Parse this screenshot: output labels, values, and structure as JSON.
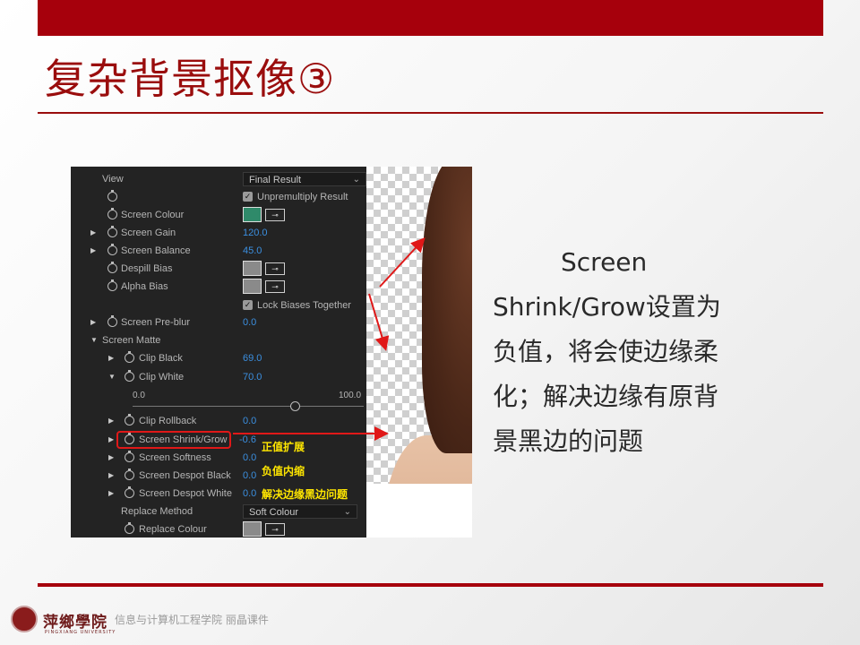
{
  "slide": {
    "title": "复杂背景抠像③",
    "footer": "信息与计算机工程学院  丽晶课件",
    "logo_text": "萍鄉學院",
    "logo_sub": "PINGXIANG UNIVERSITY"
  },
  "description": {
    "lines": [
      "Screen",
      "Shrink/Grow设置为",
      "负值，将会使边缘柔",
      "化；解决边缘有原背",
      "景黑边的问题"
    ]
  },
  "panel": {
    "view_label": "View",
    "view_value": "Final Result",
    "unpremultiply_label": "Unpremultiply Result",
    "screen_colour": {
      "label": "Screen Colour",
      "color": "#2f8a6a"
    },
    "screen_gain": {
      "label": "Screen Gain",
      "value": "120.0"
    },
    "screen_balance": {
      "label": "Screen Balance",
      "value": "45.0"
    },
    "despill_bias": {
      "label": "Despill Bias",
      "color": "#8a8a8a"
    },
    "alpha_bias": {
      "label": "Alpha Bias",
      "color": "#8a8a8a"
    },
    "lock_biases_label": "Lock Biases Together",
    "screen_preblur": {
      "label": "Screen Pre-blur",
      "value": "0.0"
    },
    "screen_matte_label": "Screen Matte",
    "clip_black": {
      "label": "Clip Black",
      "value": "69.0"
    },
    "clip_white": {
      "label": "Clip White",
      "value": "70.0"
    },
    "slider": {
      "min": "0.0",
      "max": "100.0",
      "value": 70
    },
    "clip_rollback": {
      "label": "Clip Rollback",
      "value": "0.0"
    },
    "screen_shrink_grow": {
      "label": "Screen Shrink/Grow",
      "value": "-0.6"
    },
    "screen_softness": {
      "label": "Screen Softness",
      "value": "0.0"
    },
    "screen_despot_black": {
      "label": "Screen Despot Black",
      "value": "0.0"
    },
    "screen_despot_white": {
      "label": "Screen Despot White",
      "value": "0.0"
    },
    "replace_method": {
      "label": "Replace Method",
      "value": "Soft Colour"
    },
    "replace_colour": {
      "label": "Replace Colour",
      "color": "#8a8a8a"
    }
  },
  "annotations": {
    "positive": "正值扩展",
    "negative": "负值内缩",
    "solve": "解决边缘黑边问题"
  },
  "colors": {
    "accent": "#a6000c",
    "annotation": "#ffe600",
    "value_blue": "#3b8fe0",
    "highlight": "#e01818"
  }
}
